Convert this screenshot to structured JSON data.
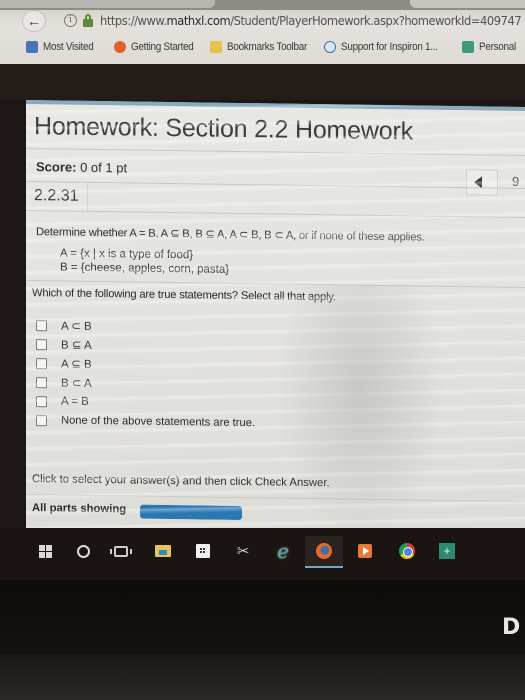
{
  "browser": {
    "url_prefix": "https://www.",
    "url_domain": "mathxl.com",
    "url_rest": "/Student/PlayerHomework.aspx?homeworkId=409747",
    "bookmarks": [
      {
        "label": "Most Visited",
        "icon": "most-visited-icon",
        "color": "#4a73b8"
      },
      {
        "label": "Getting Started",
        "icon": "firefox-icon",
        "color": "#e0612a"
      },
      {
        "label": "Bookmarks Toolbar",
        "icon": "folder-icon",
        "color": "#e8c24f"
      },
      {
        "label": "Support for Inspiron 1...",
        "icon": "dell-icon",
        "color": "#3a6fb0"
      },
      {
        "label": "Personal",
        "icon": "tax-icon",
        "color": "#3e9a7a"
      }
    ]
  },
  "homework": {
    "title": "Homework: Section 2.2 Homework",
    "score_label": "Score:",
    "score_value": " 0 of 1 pt",
    "question_number": "2.2.31",
    "nav_next_partial": "9"
  },
  "question": {
    "prompt_start": "Determine whether A = B, A ⊆ B, B ⊆ A, A ⊂ B, B ⊂ A,",
    "prompt_end": " or if none of these applies.",
    "set_a": "A = {x | x is a type of food}",
    "set_b": "B = {cheese, apples, corn, pasta}",
    "instruction": "Which of the following are true statements? Select all that apply.",
    "options": [
      {
        "label": "A ⊂ B",
        "checked": false
      },
      {
        "label": "B ⊆ A",
        "checked": false
      },
      {
        "label": "A ⊆ B",
        "checked": false
      },
      {
        "label": "B ⊂ A",
        "checked": false
      },
      {
        "label": "A = B",
        "checked": false
      },
      {
        "label": "None of the above statements are true.",
        "checked": false
      }
    ]
  },
  "footer": {
    "instruction": "Click to select your answer(s) and then click Check Answer.",
    "all_parts_label": "All parts showing",
    "progress_fraction": 1.0,
    "progress_color": "#2a78b3"
  },
  "taskbar": {
    "items": [
      {
        "name": "start-button",
        "icon": "windows-icon"
      },
      {
        "name": "cortana-button",
        "icon": "cortana-icon"
      },
      {
        "name": "task-view-button",
        "icon": "task-view-icon"
      },
      {
        "name": "file-explorer",
        "icon": "folder-icon"
      },
      {
        "name": "store",
        "icon": "store-icon"
      },
      {
        "name": "snipping-tool",
        "icon": "scissors-icon"
      },
      {
        "name": "internet-explorer",
        "icon": "ie-icon"
      },
      {
        "name": "firefox",
        "icon": "firefox-icon",
        "active": true
      },
      {
        "name": "media-player",
        "icon": "media-icon"
      },
      {
        "name": "chrome",
        "icon": "chrome-icon"
      },
      {
        "name": "app-plus",
        "icon": "plus-icon"
      }
    ]
  },
  "hardware": {
    "brand_partial": "D"
  }
}
